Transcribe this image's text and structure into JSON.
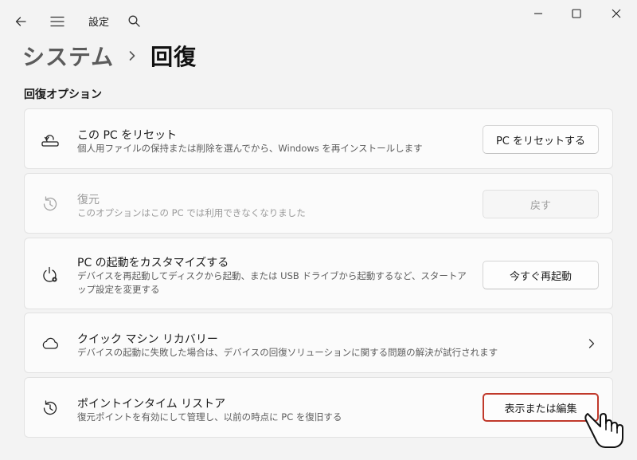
{
  "titlebar": {
    "app_title": "設定",
    "icons": [
      "back-arrow-icon",
      "hamburger-menu-icon",
      "search-icon",
      "minimize-icon",
      "maximize-icon",
      "close-icon"
    ]
  },
  "breadcrumb": {
    "parent": "システム",
    "current": "回復"
  },
  "section": {
    "title": "回復オプション"
  },
  "cards": [
    {
      "icon": "reset-pc-icon",
      "title": "この PC をリセット",
      "description": "個人用ファイルの保持または削除を選んでから、Windows を再インストールします",
      "button": "PC をリセットする",
      "enabled": true
    },
    {
      "icon": "history-icon",
      "title": "復元",
      "description": "このオプションはこの PC では利用できなくなりました",
      "button": "戻す",
      "enabled": false
    },
    {
      "icon": "power-gear-icon",
      "title": "PC の起動をカスタマイズする",
      "description": "デバイスを再起動してディスクから起動、または USB ドライブから起動するなど、スタートアップ設定を変更する",
      "button": "今すぐ再起動",
      "enabled": true
    },
    {
      "icon": "cloud-icon",
      "title": "クイック マシン リカバリー",
      "description": "デバイスの起動に失敗した場合は、デバイスの回復ソリューションに関する問題の解決が試行されます",
      "action": "chevron-right-icon",
      "enabled": true
    },
    {
      "icon": "restore-clock-icon",
      "title": "ポイントインタイム リストア",
      "description": "復元ポイントを有効にして管理し、以前の時点に PC を復旧する",
      "button": "表示または編集",
      "enabled": true,
      "highlighted": true
    }
  ],
  "colors": {
    "background": "#f3f3f3",
    "card": "#fbfbfb",
    "highlight_border": "#c0392b"
  }
}
